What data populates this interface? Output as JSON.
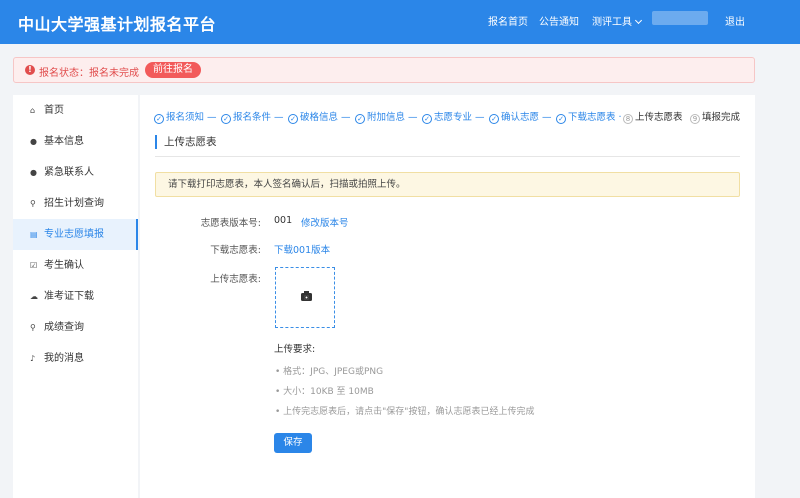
{
  "header": {
    "title": "中山大学强基计划报名平台",
    "nav": {
      "home": "报名首页",
      "notice": "公告通知",
      "tools": "测评工具",
      "logout": "退出"
    }
  },
  "alert": {
    "icon": "exclamation-icon",
    "text": "报名状态：报名未完成",
    "button": "前往报名",
    "color": "#e14d4d"
  },
  "sidebar": {
    "items": [
      {
        "label": "首页",
        "icon": "home-icon",
        "glyph": "⌂"
      },
      {
        "label": "基本信息",
        "icon": "user-icon",
        "glyph": "●"
      },
      {
        "label": "紧急联系人",
        "icon": "user-icon",
        "glyph": "●"
      },
      {
        "label": "招生计划查询",
        "icon": "search-icon",
        "glyph": "⚲"
      },
      {
        "label": "专业志愿填报",
        "icon": "document-icon",
        "glyph": "▤"
      },
      {
        "label": "考生确认",
        "icon": "check-square-icon",
        "glyph": "☑"
      },
      {
        "label": "准考证下载",
        "icon": "cloud-download-icon",
        "glyph": "☁"
      },
      {
        "label": "成绩查询",
        "icon": "search-icon",
        "glyph": "⚲"
      },
      {
        "label": "我的消息",
        "icon": "bell-icon",
        "glyph": "♪"
      }
    ],
    "active_index": 4
  },
  "steps": [
    {
      "label": "报名须知",
      "done": true
    },
    {
      "label": "报名条件",
      "done": true
    },
    {
      "label": "破格信息",
      "done": true
    },
    {
      "label": "附加信息",
      "done": true
    },
    {
      "label": "志愿专业",
      "done": true
    },
    {
      "label": "确认志愿",
      "done": true
    },
    {
      "label": "下载志愿表",
      "done": true
    },
    {
      "label": "上传志愿表",
      "done": false,
      "number": "8"
    },
    {
      "label": "填报完成",
      "done": false,
      "number": "9"
    }
  ],
  "section": {
    "title": "上传志愿表",
    "notice": "请下载打印志愿表，本人签名确认后，扫描或拍照上传。"
  },
  "form": {
    "version_label": "志愿表版本号:",
    "version_value": "001",
    "modify_link": "修改版本号",
    "download_label": "下载志愿表:",
    "download_link": "下载001版本",
    "upload_label": "上传志愿表:"
  },
  "requirements": {
    "title": "上传要求:",
    "items": [
      "格式：JPG、JPEG或PNG",
      "大小：10KB 至 10MB",
      "上传完志愿表后，请点击\"保存\"按钮，确认志愿表已经上传完成"
    ]
  },
  "save_button": "保存",
  "colors": {
    "primary": "#2b86e8",
    "danger": "#e14d4d",
    "warning_bg": "#fdf7e3"
  }
}
